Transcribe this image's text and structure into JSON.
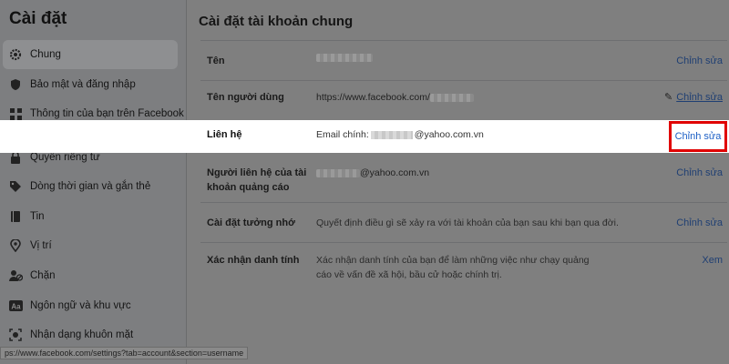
{
  "sidebar": {
    "title": "Cài đặt",
    "items": [
      {
        "label": "Chung",
        "icon": "gear-icon"
      },
      {
        "label": "Bảo mật và đăng nhập",
        "icon": "shield-icon"
      },
      {
        "label": "Thông tin của bạn trên Facebook",
        "icon": "grid-icon"
      },
      {
        "label": "Quyền riêng tư",
        "icon": "lock-icon"
      },
      {
        "label": "Dòng thời gian và gắn thẻ",
        "icon": "tag-icon"
      },
      {
        "label": "Tin",
        "icon": "book-icon"
      },
      {
        "label": "Vị trí",
        "icon": "location-pin-icon"
      },
      {
        "label": "Chặn",
        "icon": "user-block-icon"
      },
      {
        "label": "Ngôn ngữ và khu vực",
        "icon": "language-icon"
      },
      {
        "label": "Nhận dạng khuôn mặt",
        "icon": "face-icon"
      }
    ]
  },
  "main": {
    "title": "Cài đặt tài khoản chung",
    "rows": [
      {
        "label": "Tên",
        "value": "",
        "action": "Chỉnh sửa"
      },
      {
        "label": "Tên người dùng",
        "value": "https://www.facebook.com/",
        "action": "Chỉnh sửa"
      },
      {
        "label": "Liên hệ",
        "value_prefix": "Email chính:",
        "value_suffix": "@yahoo.com.vn",
        "action": "Chỉnh sửa"
      },
      {
        "label_line1": "Người liên hệ của tài",
        "label_line2": "khoản quảng cáo",
        "value": "@yahoo.com.vn",
        "action": "Chỉnh sửa"
      },
      {
        "label": "Cài đặt tưởng nhớ",
        "value": "Quyết định điều gì sẽ xảy ra với tài khoản của bạn sau khi bạn qua đời.",
        "action": "Chỉnh sửa"
      },
      {
        "label": "Xác nhận danh tính",
        "value_line1": "Xác nhận danh tính của bạn để làm những việc như chạy quảng",
        "value_line2": "cáo về vấn đề xã hội, bầu cử hoặc chính trị.",
        "action": "Xem"
      }
    ]
  },
  "status_bar": {
    "url": "ps://www.facebook.com/settings?tab=account&section=username"
  },
  "colors": {
    "highlight_border": "#e00000",
    "link": "#1c5fc5"
  }
}
